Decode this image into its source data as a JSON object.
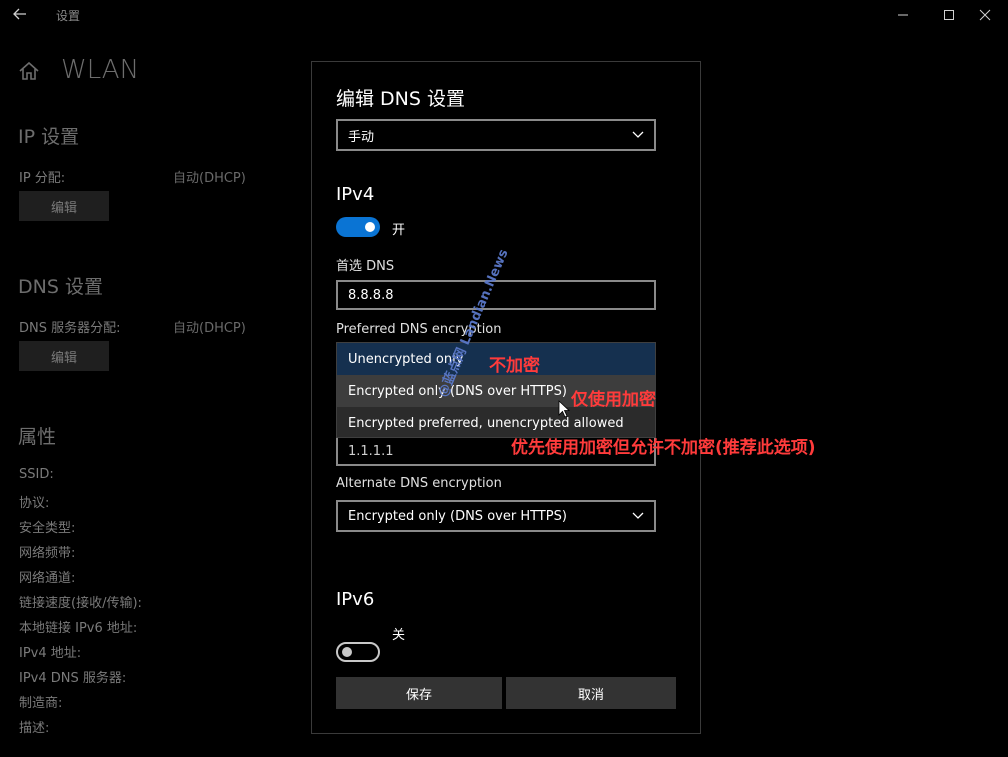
{
  "titlebar": {
    "app_title": "设置",
    "back_icon": "back-arrow-icon",
    "minimize_icon": "minimize-icon",
    "maximize_icon": "maximize-icon",
    "close_icon": "close-icon"
  },
  "page": {
    "home_icon": "home-icon",
    "title": "WLAN",
    "ip_section": {
      "title": "IP 设置",
      "label": "IP 分配:",
      "value": "自动(DHCP)",
      "edit_label": "编辑"
    },
    "dns_section": {
      "title": "DNS 设置",
      "label": "DNS 服务器分配:",
      "value": "自动(DHCP)",
      "edit_label": "编辑"
    },
    "properties": {
      "title": "属性",
      "labels": [
        "SSID:",
        "协议:",
        "安全类型:",
        "网络频带:",
        "网络通道:",
        "链接速度(接收/传输):",
        "本地链接 IPv6 地址:",
        "IPv4 地址:",
        "IPv4 DNS 服务器:",
        "制造商:",
        "描述:"
      ]
    }
  },
  "dialog": {
    "title": "编辑 DNS 设置",
    "mode_select": "手动",
    "ipv4": {
      "title": "IPv4",
      "toggle_state": "on",
      "toggle_label": "开",
      "preferred_dns_label": "首选 DNS",
      "preferred_dns_value": "8.8.8.8",
      "preferred_encryption_label": "Preferred DNS encryption",
      "encryption_options": [
        "Unencrypted only",
        "Encrypted only (DNS over HTTPS)",
        "Encrypted preferred, unencrypted allowed"
      ],
      "selected_option_index": 0,
      "hovered_option_index": 1,
      "alternate_dns_value": "1.1.1.1",
      "alternate_encryption_label": "Alternate DNS encryption",
      "alternate_encryption_value": "Encrypted only (DNS over HTTPS)"
    },
    "ipv6": {
      "title": "IPv6",
      "toggle_state": "off",
      "toggle_label": "关"
    },
    "save_label": "保存",
    "cancel_label": "取消"
  },
  "annotations": {
    "unencrypted": "不加密",
    "encrypted_only": "仅使用加密",
    "preferred": "优先使用加密但允许不加密(推荐此选项)"
  },
  "watermark": "@蓝点网 Landian.News",
  "colors": {
    "accent": "#0a74d4",
    "annotation": "#ff3b3b",
    "background": "#000000"
  }
}
